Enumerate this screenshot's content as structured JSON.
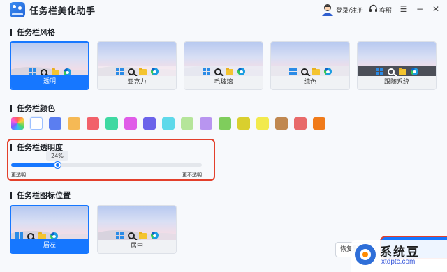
{
  "app": {
    "title": "任务栏美化助手",
    "login_label": "登录/注册",
    "service_label": "客服"
  },
  "sections": {
    "style_title": "任务栏风格",
    "color_title": "任务栏颜色",
    "transparency_title": "任务栏透明度",
    "icon_position_title": "任务栏图标位置"
  },
  "styles": [
    {
      "label": "透明",
      "selected": true
    },
    {
      "label": "亚克力",
      "selected": false
    },
    {
      "label": "毛玻璃",
      "selected": false
    },
    {
      "label": "纯色",
      "selected": false
    },
    {
      "label": "跟随系统",
      "selected": false
    }
  ],
  "colors": [
    "rainbow",
    "#ffffff",
    "#5b7ef0",
    "#f5b955",
    "#f2616a",
    "#3fd9a2",
    "#e05ce8",
    "#6b63ea",
    "#5fd9ea",
    "#b5e59a",
    "#b895f0",
    "#7fcd5c",
    "#d9cf2e",
    "#f2ea4d",
    "#c08850",
    "#e86a6a",
    "#f07b1a"
  ],
  "selected_color": "#ffffff",
  "transparency": {
    "value": 0.24,
    "value_label": "24%",
    "min_label": "更透明",
    "max_label": "更不透明"
  },
  "icon_positions": [
    {
      "label": "居左",
      "selected": true
    },
    {
      "label": "居中",
      "selected": false
    }
  ],
  "buttons": {
    "reset_label": "恢复默认"
  },
  "watermark": {
    "title": "系统豆",
    "url": "xtdptc.com"
  },
  "accent_color": "#1677ff",
  "highlight_color": "#e3402b"
}
